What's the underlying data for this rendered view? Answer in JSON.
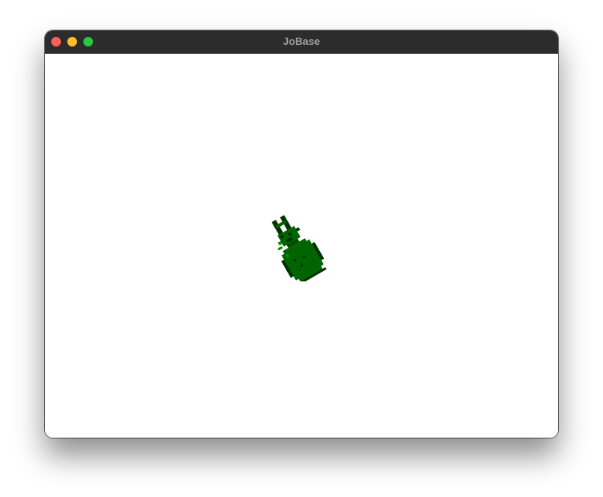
{
  "window": {
    "title": "JoBase"
  },
  "controls": {
    "close_icon": "close-traffic-light",
    "minimize_icon": "minimize-traffic-light",
    "zoom_icon": "zoom-traffic-light"
  },
  "colors": {
    "titlebar": "#2c2c2c",
    "title_text": "#9e9e9e",
    "close": "#fe5f57",
    "minimize": "#febc2e",
    "zoom": "#28c840",
    "sprite_body": "#006400",
    "sprite_dark": "#003300",
    "sprite_light": "#0a8a0a"
  },
  "canvas": {
    "sprite": "green-pixel-creature"
  }
}
